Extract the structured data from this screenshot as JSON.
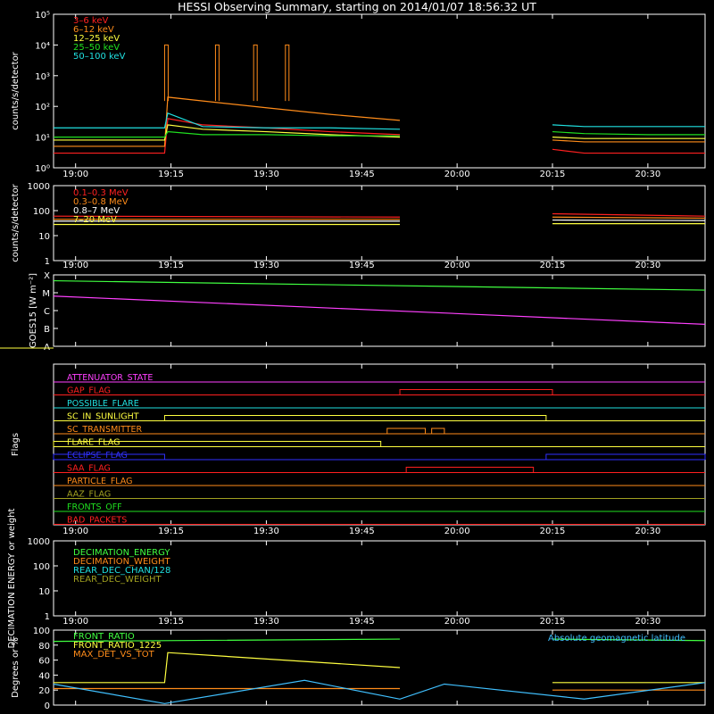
{
  "title": "HESSI Observing Summary, starting on 2014/01/07 18:56:32 UT",
  "time_axis": {
    "start": "18:56:32",
    "end": "20:39:00",
    "ticks": [
      "19:00",
      "19:15",
      "19:30",
      "19:45",
      "20:00",
      "20:15",
      "20:30"
    ]
  },
  "chart_data": [
    {
      "type": "line",
      "ylabel": "counts/s/detector",
      "yscale": "log",
      "ylim": [
        1,
        100000
      ],
      "yticks": [
        "10⁰",
        "10¹",
        "10²",
        "10³",
        "10⁴",
        "10⁵"
      ],
      "legend_position": "top-left",
      "data_gap": [
        "19:51",
        "20:15"
      ],
      "series": [
        {
          "name": "3–6 keV",
          "color": "#ff2020",
          "x": [
            "18:56:32",
            "19:14",
            "19:14:30",
            "19:20",
            "19:30",
            "19:40",
            "19:51",
            "20:15",
            "20:20",
            "20:30",
            "20:39"
          ],
          "y": [
            3,
            3,
            40,
            25,
            20,
            15,
            12,
            4,
            3,
            3,
            3
          ]
        },
        {
          "name": "6–12 keV",
          "color": "#ff8c1a",
          "x": [
            "18:56:32",
            "19:14",
            "19:14:30",
            "19:20",
            "19:30",
            "19:40",
            "19:51",
            "20:15",
            "20:20",
            "20:30",
            "20:39"
          ],
          "y": [
            5,
            5,
            200,
            150,
            90,
            55,
            35,
            8,
            7,
            7,
            7
          ]
        },
        {
          "name": "12–25 keV",
          "color": "#ffff40",
          "x": [
            "18:56:32",
            "19:14",
            "19:14:30",
            "19:20",
            "19:30",
            "19:40",
            "19:51",
            "20:15",
            "20:20",
            "20:30",
            "20:39"
          ],
          "y": [
            8,
            8,
            25,
            18,
            15,
            12,
            10,
            10,
            9,
            9,
            9
          ]
        },
        {
          "name": "25–50 keV",
          "color": "#20e020",
          "x": [
            "18:56:32",
            "19:14",
            "19:14:30",
            "19:20",
            "19:30",
            "19:40",
            "19:51",
            "20:15",
            "20:20",
            "20:30",
            "20:39"
          ],
          "y": [
            10,
            10,
            15,
            12,
            12,
            11,
            11,
            15,
            13,
            12,
            12
          ]
        },
        {
          "name": "50–100 keV",
          "color": "#20e0e0",
          "x": [
            "18:56:32",
            "19:14",
            "19:14:30",
            "19:20",
            "19:30",
            "19:40",
            "19:51",
            "20:15",
            "20:20",
            "20:30",
            "20:39"
          ],
          "y": [
            20,
            20,
            60,
            22,
            20,
            20,
            18,
            25,
            22,
            22,
            22
          ]
        }
      ],
      "spikes": {
        "x": [
          "19:14",
          "19:22",
          "19:28",
          "19:33"
        ],
        "y": 10000
      }
    },
    {
      "type": "line",
      "ylabel": "counts/s/detector",
      "yscale": "log",
      "ylim": [
        1,
        1000
      ],
      "yticks": [
        "1",
        "10",
        "100",
        "1000"
      ],
      "legend_position": "top-left",
      "series": [
        {
          "name": "0.1–0.3 MeV",
          "color": "#ff2020",
          "x": [
            "18:56:32",
            "19:51",
            "20:15",
            "20:39"
          ],
          "y": [
            60,
            55,
            75,
            60
          ]
        },
        {
          "name": "0.3–0.8 MeV",
          "color": "#ff8c1a",
          "x": [
            "18:56:32",
            "19:51",
            "20:15",
            "20:39"
          ],
          "y": [
            45,
            45,
            55,
            50
          ]
        },
        {
          "name": "0.8–7 MeV",
          "color": "#ffffff",
          "x": [
            "18:56:32",
            "19:51",
            "20:15",
            "20:39"
          ],
          "y": [
            38,
            38,
            42,
            40
          ]
        },
        {
          "name": "7–20 MeV",
          "color": "#ffff40",
          "x": [
            "18:56:32",
            "19:51",
            "20:15",
            "20:39"
          ],
          "y": [
            28,
            28,
            30,
            30
          ]
        }
      ]
    },
    {
      "type": "line",
      "ylabel": "GOES15 [W m⁻²]",
      "yscale": "log",
      "yticks": [
        "A",
        "B",
        "C",
        "M",
        "X"
      ],
      "series": [
        {
          "color": "#40ff40",
          "x": [
            "18:56:32",
            "20:39"
          ],
          "y": [
            4.7e-05,
            1.4e-05
          ]
        },
        {
          "color": "#ff40ff",
          "x": [
            "18:56:32",
            "20:39"
          ],
          "y": [
            6.5e-06,
            1.7e-07
          ]
        }
      ]
    },
    {
      "type": "flags",
      "ylabel": "Flags",
      "rows": [
        {
          "label": "ATTENUATOR_STATE",
          "color": "#ff40ff",
          "on": []
        },
        {
          "label": "GAP_FLAG",
          "color": "#ff2020",
          "on": [
            [
              "19:51",
              "20:15"
            ]
          ]
        },
        {
          "label": "POSSIBLE_FLARE",
          "color": "#20e0e0",
          "on": []
        },
        {
          "label": "SC_IN_SUNLIGHT",
          "color": "#ffff40",
          "on": [
            [
              "19:14",
              "20:14"
            ]
          ]
        },
        {
          "label": "SC_TRANSMITTER",
          "color": "#ff8c1a",
          "on": [
            [
              "19:49",
              "19:55"
            ],
            [
              "19:56",
              "19:58"
            ]
          ]
        },
        {
          "label": "FLARE_FLAG",
          "color": "#ffff40",
          "on": [
            [
              "18:56:32",
              "19:48"
            ]
          ]
        },
        {
          "label": "ECLIPSE_FLAG",
          "color": "#3030ff",
          "on": [
            [
              "18:56:32",
              "19:14"
            ],
            [
              "20:14",
              "20:39"
            ]
          ]
        },
        {
          "label": "SAA_FLAG",
          "color": "#ff2020",
          "on": [
            [
              "19:52",
              "20:12"
            ]
          ]
        },
        {
          "label": "PARTICLE_FLAG",
          "color": "#ff8c1a",
          "on": []
        },
        {
          "label": "AAZ_FLAG",
          "color": "#a0a020",
          "on": []
        },
        {
          "label": "FRONTS_OFF",
          "color": "#20e020",
          "on": []
        },
        {
          "label": "BAD_PACKETS",
          "color": "#ff2020",
          "on": []
        }
      ]
    },
    {
      "type": "line",
      "ylabel": "DECIMATION ENERGY or weight",
      "yscale": "log",
      "ylim": [
        1,
        1000
      ],
      "yticks": [
        "1",
        "10",
        "100",
        "1000"
      ],
      "legend_position": "top-left",
      "series": [
        {
          "name": "DECIMATION_ENERGY",
          "color": "#40ff40",
          "x": [],
          "y": []
        },
        {
          "name": "DECIMATION_WEIGHT",
          "color": "#ff8c1a",
          "x": [],
          "y": []
        },
        {
          "name": "REAR_DEC_CHAN/128",
          "color": "#20e0e0",
          "x": [],
          "y": []
        },
        {
          "name": "REAR_DEC_WEIGHT",
          "color": "#a0a020",
          "x": [],
          "y": []
        }
      ]
    },
    {
      "type": "line",
      "ylabel": "Degrees or %",
      "ylim": [
        0,
        100
      ],
      "yticks": [
        "0",
        "20",
        "40",
        "60",
        "80",
        "100"
      ],
      "legend_position": "top-left",
      "series": [
        {
          "name": "FRONT_RATIO",
          "color": "#40ff40",
          "x": [
            "18:56:32",
            "19:51",
            "20:15",
            "20:39"
          ],
          "y": [
            85,
            88,
            88,
            86
          ]
        },
        {
          "name": "FRONT_RATIO_1225",
          "color": "#ffff40",
          "x": [
            "18:56:32",
            "19:14",
            "19:14:30",
            "19:51",
            "20:15",
            "20:39"
          ],
          "y": [
            30,
            30,
            70,
            50,
            30,
            30
          ]
        },
        {
          "name": "MAX_DET_VS_TOT",
          "color": "#ff8c1a",
          "x": [
            "18:56:32",
            "19:51",
            "20:15",
            "20:39"
          ],
          "y": [
            22,
            22,
            20,
            20
          ]
        },
        {
          "name": "Absolute geomagnetic latitude",
          "color": "#40c0ff",
          "x": [
            "18:56:32",
            "19:14",
            "19:36",
            "19:51",
            "19:58",
            "20:20",
            "20:39"
          ],
          "y": [
            28,
            2,
            33,
            8,
            28,
            8,
            30
          ]
        }
      ]
    }
  ]
}
